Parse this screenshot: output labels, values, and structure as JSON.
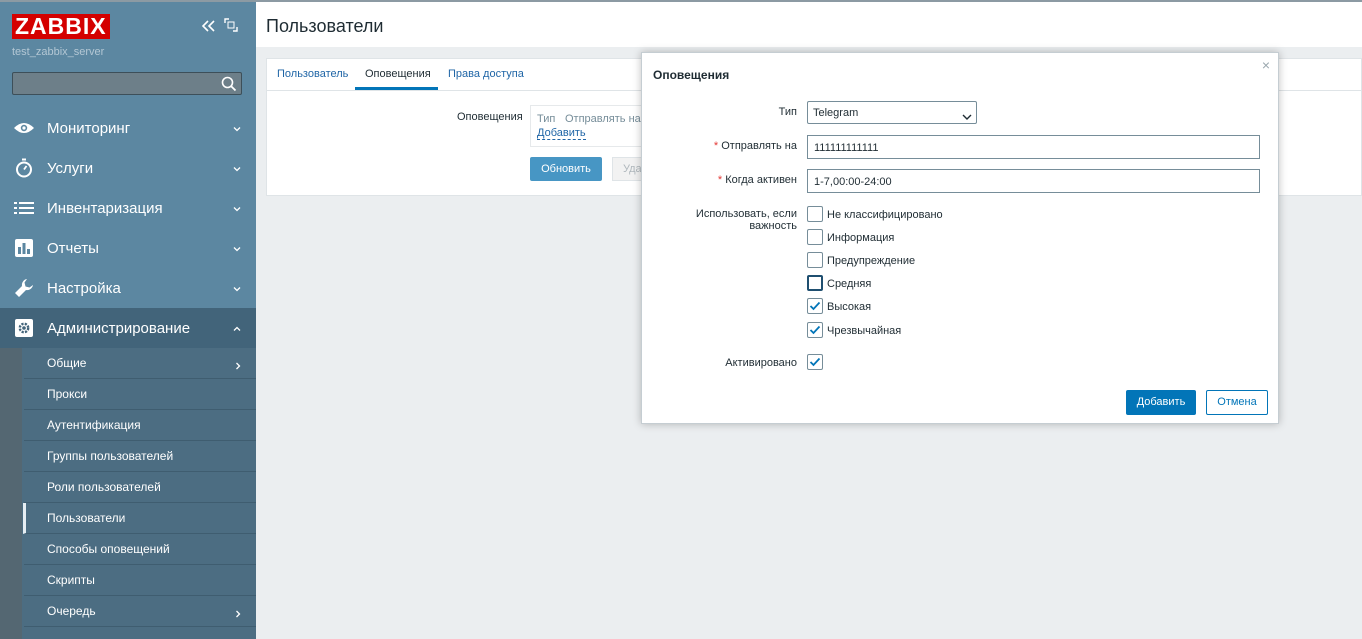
{
  "app": {
    "logo": "ZABBIX",
    "server_name": "test_zabbix_server"
  },
  "sidebar": {
    "menu": [
      {
        "label": "Мониторинг",
        "icon": "eye-icon"
      },
      {
        "label": "Услуги",
        "icon": "stopwatch-icon"
      },
      {
        "label": "Инвентаризация",
        "icon": "list-icon"
      },
      {
        "label": "Отчеты",
        "icon": "bar-chart-icon"
      },
      {
        "label": "Настройка",
        "icon": "wrench-icon"
      },
      {
        "label": "Администрирование",
        "icon": "gear-icon",
        "expanded": true
      }
    ],
    "submenu": [
      {
        "label": "Общие",
        "has_children": true
      },
      {
        "label": "Прокси"
      },
      {
        "label": "Аутентификация"
      },
      {
        "label": "Группы пользователей"
      },
      {
        "label": "Роли пользователей"
      },
      {
        "label": "Пользователи",
        "selected": true
      },
      {
        "label": "Способы оповещений"
      },
      {
        "label": "Скрипты"
      },
      {
        "label": "Очередь",
        "has_children": true
      }
    ]
  },
  "page": {
    "title": "Пользователи",
    "tabs": [
      {
        "label": "Пользователь"
      },
      {
        "label": "Оповещения",
        "active": true
      },
      {
        "label": "Права доступа"
      }
    ],
    "media_label": "Оповещения",
    "media_table": {
      "col_type": "Тип",
      "col_sendto": "Отправлять на",
      "add_link": "Добавить"
    },
    "update_button": "Обновить",
    "delete_button": "Уда"
  },
  "dialog": {
    "title": "Оповещения",
    "close": "×",
    "type_label": "Тип",
    "type_value": "Telegram",
    "sendto_label": "Отправлять на",
    "sendto_value": "111111111111",
    "when_label": "Когда активен",
    "when_value": "1-7,00:00-24:00",
    "severity_label": "Использовать, если важность",
    "severities": [
      {
        "label": "Не классифицировано",
        "checked": false
      },
      {
        "label": "Информация",
        "checked": false
      },
      {
        "label": "Предупреждение",
        "checked": false
      },
      {
        "label": "Средняя",
        "checked": false,
        "focused": true
      },
      {
        "label": "Высокая",
        "checked": true
      },
      {
        "label": "Чрезвычайная",
        "checked": true
      }
    ],
    "enabled_label": "Активировано",
    "enabled_checked": true,
    "add_button": "Добавить",
    "cancel_button": "Отмена"
  },
  "colors": {
    "sidebar": "#5c87a1",
    "accent": "#0275b8",
    "logo_red": "#d40000",
    "required": "#e33734"
  }
}
